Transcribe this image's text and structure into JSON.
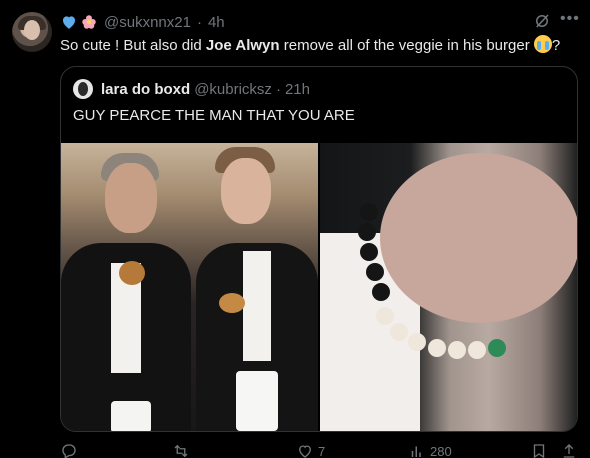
{
  "tweet": {
    "handle": "@sukxnnx21",
    "separator": "·",
    "time": "4h",
    "text_before": "So cute ! But also did ",
    "mention_1": "Joe Alwyn",
    "text_after": " remove all of the veggie in his burger ",
    "text_end": "?"
  },
  "quote": {
    "name": "lara do boxd",
    "handle": "@kubricksz",
    "separator": "·",
    "time": "21h",
    "text": "GUY PEARCE THE MAN THAT YOU ARE"
  },
  "actions": {
    "reply_count": "",
    "retweet_count": "",
    "like_count": "7",
    "views_count": "280"
  },
  "colors": {
    "background": "#000000",
    "text": "#e7e9ea",
    "secondary": "#71767b",
    "border": "#2f3336",
    "heart_blue": "#5dadec"
  }
}
